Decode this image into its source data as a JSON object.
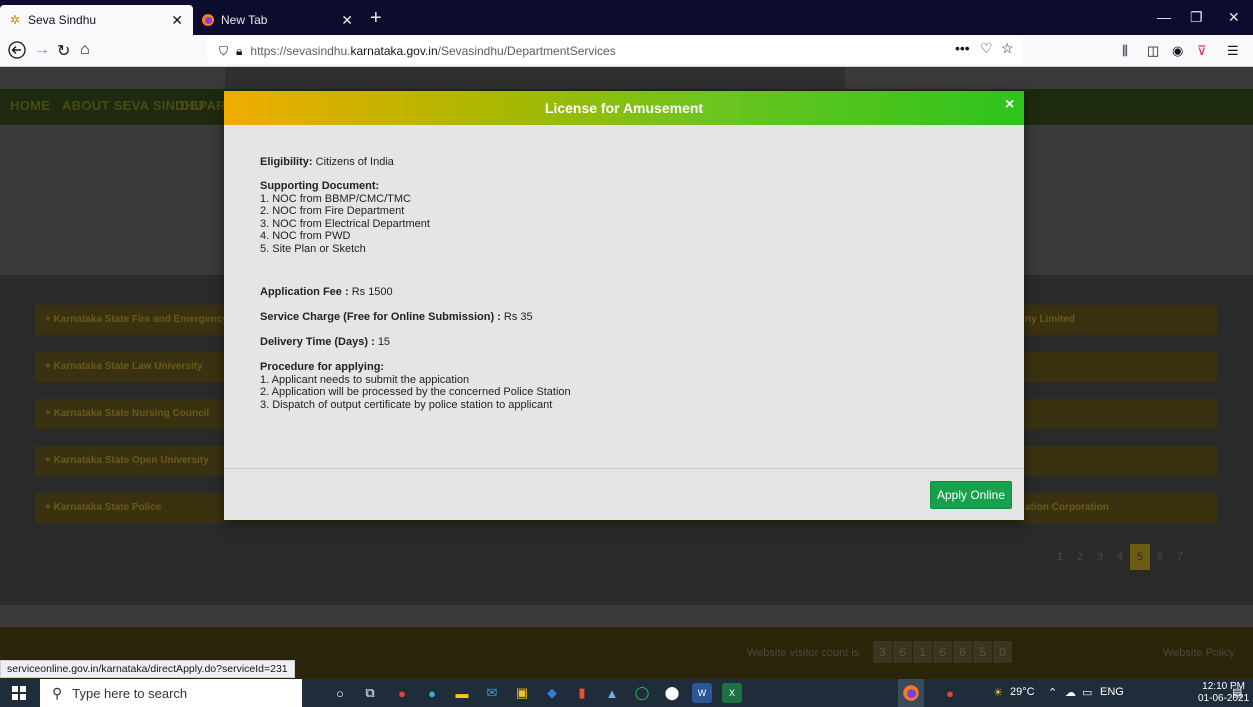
{
  "browser": {
    "tabs": [
      {
        "title": "Seva Sindhu",
        "active": true,
        "icon": "seva-sindhu-favicon"
      },
      {
        "title": "New Tab",
        "active": false,
        "icon": "firefox-icon"
      }
    ],
    "new_tab_symbol": "+",
    "url_prefix": "https://sevasindhu.",
    "url_domain": "karnataka.gov.in",
    "url_path": "/Sevasindhu/DepartmentServices",
    "page_actions": "•••"
  },
  "page": {
    "nav_items": [
      "HOME",
      "ABOUT SEVA SINDHU",
      "DEPART"
    ],
    "departments": [
      "+ Karnataka State Fire and Emergency",
      "+ Karnataka State Law University",
      "+ Karnataka State Nursing Council",
      "+ Karnataka State Open University",
      "+ Karnataka State Police"
    ],
    "right_column": [
      "ny Limited",
      "",
      "",
      "",
      "ation Corporation"
    ],
    "pager": [
      "1",
      "2",
      "3",
      "4",
      "5",
      "6",
      "7"
    ],
    "pager_current": "5",
    "visitor_label": "Website visitor count is",
    "visitor_digits": [
      "3",
      "6",
      "1",
      "6",
      "6",
      "5",
      "0"
    ],
    "website_policy": "Website Policy"
  },
  "modal": {
    "title": "License for Amusement",
    "close_symbol": "×",
    "eligibility_label": "Eligibility:",
    "eligibility_value": "Citizens of India",
    "supporting_label": "Supporting Document:",
    "documents": [
      "1. NOC from BBMP/CMC/TMC",
      "2. NOC from Fire Department",
      "3. NOC from Electrical Department",
      "4. NOC from PWD",
      "5. Site Plan or Sketch"
    ],
    "fee_label": "Application Fee :",
    "fee_value": "Rs 1500",
    "charge_label": "Service Charge (Free for Online Submission) :",
    "charge_value": "Rs 35",
    "delivery_label": "Delivery Time (Days) :",
    "delivery_value": "15",
    "procedure_label": "Procedure for applying:",
    "procedure": [
      "1. Applicant needs to submit the appication",
      "2. Application will be processed by the concerned Police Station",
      "3. Dispatch of output certificate by police station to applicant"
    ],
    "apply_button": "Apply Online"
  },
  "statusbar": {
    "url": "serviceonline.gov.in/karnataka/directApply.do?serviceId=231"
  },
  "taskbar": {
    "search_placeholder": "Type here to search",
    "weather": "29°C",
    "language": "ENG",
    "time": "12:10 PM",
    "date": "01-06-2021",
    "notification_count": "2"
  },
  "colors": {
    "modal_gradient_start": "#f0ac00",
    "modal_gradient_end": "#2cc41c",
    "apply_button": "#18a14c",
    "tab_bar": "#0c0c2e"
  }
}
